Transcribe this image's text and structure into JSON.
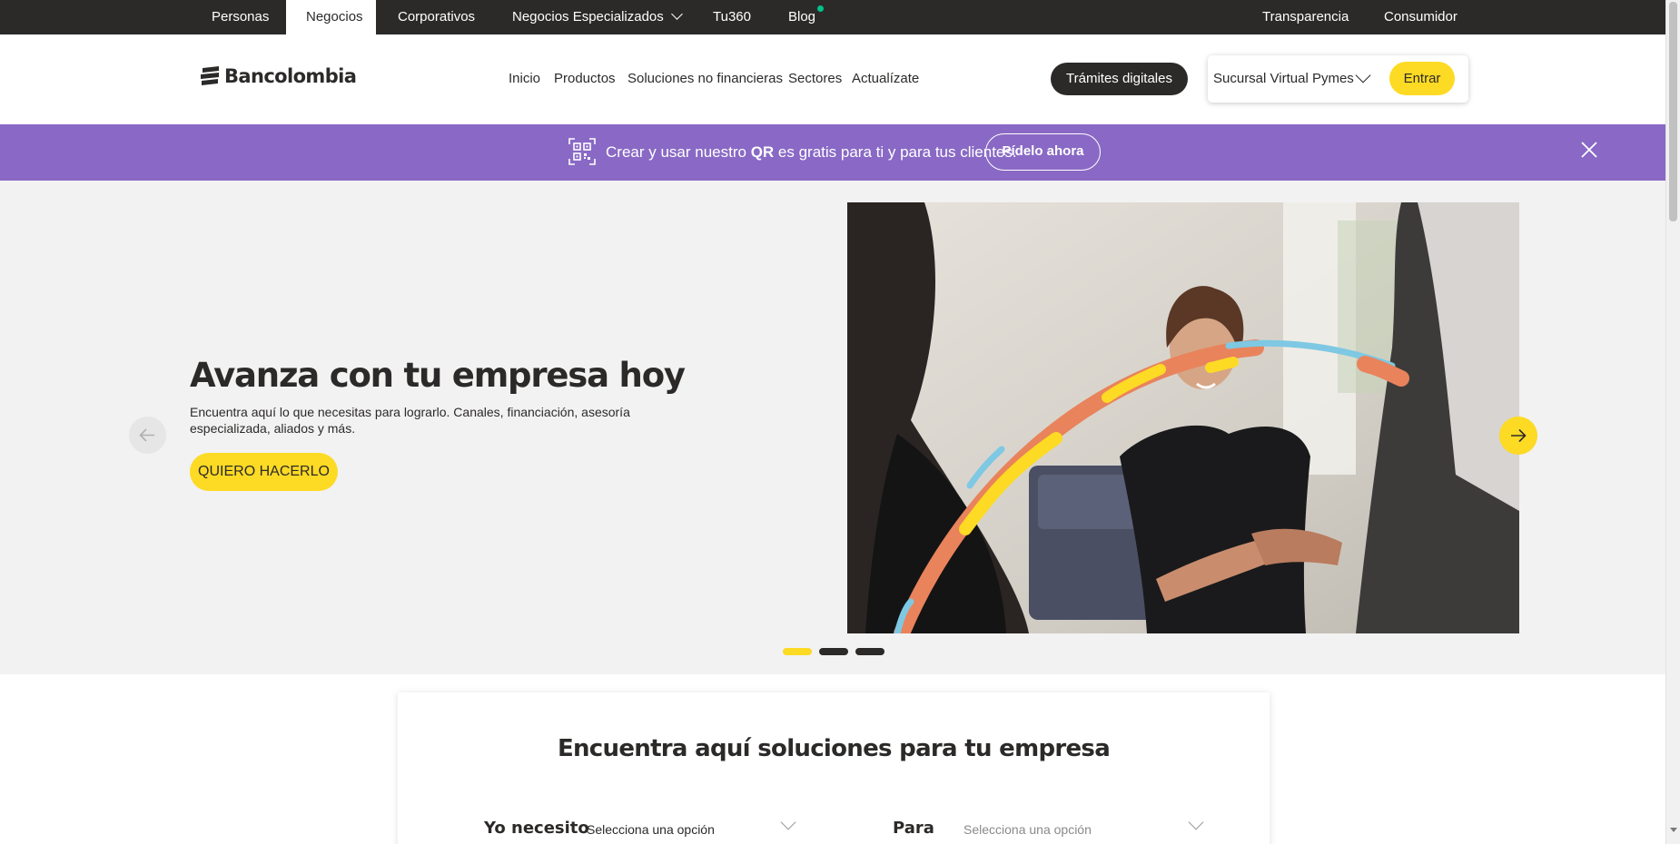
{
  "topbar": {
    "items": [
      {
        "label": "Personas",
        "active": false
      },
      {
        "label": "Negocios",
        "active": true
      },
      {
        "label": "Corporativos",
        "active": false
      },
      {
        "label": "Negocios Especializados",
        "active": false
      },
      {
        "label": "Tu360",
        "active": false
      },
      {
        "label": "Blog",
        "active": false
      }
    ],
    "right_items": [
      {
        "label": "Transparencia"
      },
      {
        "label": "Consumidor"
      }
    ]
  },
  "header": {
    "logo_text": "Bancolombia",
    "nav": [
      {
        "label": "Inicio"
      },
      {
        "label": "Productos"
      },
      {
        "label": "Soluciones no financieras"
      },
      {
        "label": "Sectores"
      },
      {
        "label": "Actualízate"
      }
    ],
    "tramites_label": "Trámites digitales",
    "sucursal_label": "Sucursal Virtual Pymes",
    "entrar_label": "Entrar"
  },
  "promo": {
    "text_before": "Crear y usar nuestro ",
    "text_bold": "QR",
    "text_after": " es gratis para ti y para tus clientes.",
    "button_label": "Pídelo ahora"
  },
  "hero": {
    "title": "Avanza con tu empresa hoy",
    "description": "Encuentra aquí lo que necesitas para lograrlo. Canales, financiación, asesoría especializada, aliados y más.",
    "cta_label": "QUIERO HACERLO",
    "slide_count": 3,
    "active_slide": 1
  },
  "solutions": {
    "title": "Encuentra aquí soluciones para tu empresa",
    "field1_label": "Yo necesito",
    "field1_placeholder": "Selecciona una opción",
    "field2_label": "Para",
    "field2_placeholder": "Selecciona una opción"
  },
  "colors": {
    "dark": "#2c2a29",
    "yellow": "#fdda24",
    "promo_purple": "#8969c5",
    "hero_bg": "#f2f2f2"
  },
  "icons": [
    "chevron-down-icon",
    "notification-dot-icon",
    "logo-mark-icon",
    "qr-code-icon",
    "close-icon",
    "arrow-left-icon",
    "arrow-right-icon"
  ]
}
